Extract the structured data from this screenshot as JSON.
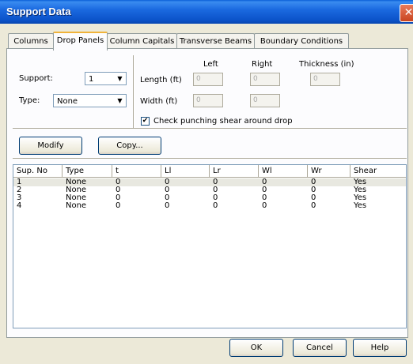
{
  "window": {
    "title": "Support Data",
    "close_glyph": "✕"
  },
  "tabs": [
    {
      "label": "Columns",
      "active": false
    },
    {
      "label": "Drop Panels",
      "active": true
    },
    {
      "label": "Column Capitals",
      "active": false
    },
    {
      "label": "Transverse Beams",
      "active": false
    },
    {
      "label": "Boundary Conditions",
      "active": false
    }
  ],
  "form": {
    "support_label": "Support:",
    "support_value": "1",
    "type_label": "Type:",
    "type_value": "None",
    "col_left": "Left",
    "col_right": "Right",
    "col_thickness": "Thickness (in)",
    "length_label": "Length (ft)",
    "width_label": "Width (ft)",
    "length_left": "0",
    "length_right": "0",
    "width_left": "0",
    "width_right": "0",
    "thickness": "0",
    "punch_check_label": "Check punching shear around drop",
    "punch_checked": true,
    "check_glyph": "✔"
  },
  "buttons": {
    "modify": "Modify",
    "copy": "Copy...",
    "ok": "OK",
    "cancel": "Cancel",
    "help": "Help"
  },
  "table": {
    "columns": [
      "Sup. No",
      "Type",
      "t",
      "Ll",
      "Lr",
      "Wl",
      "Wr",
      "Shear"
    ],
    "rows": [
      [
        "1",
        "None",
        "0",
        "0",
        "0",
        "0",
        "0",
        "Yes"
      ],
      [
        "2",
        "None",
        "0",
        "0",
        "0",
        "0",
        "0",
        "Yes"
      ],
      [
        "3",
        "None",
        "0",
        "0",
        "0",
        "0",
        "0",
        "Yes"
      ],
      [
        "4",
        "None",
        "0",
        "0",
        "0",
        "0",
        "0",
        "Yes"
      ]
    ],
    "selected_row": 0
  }
}
